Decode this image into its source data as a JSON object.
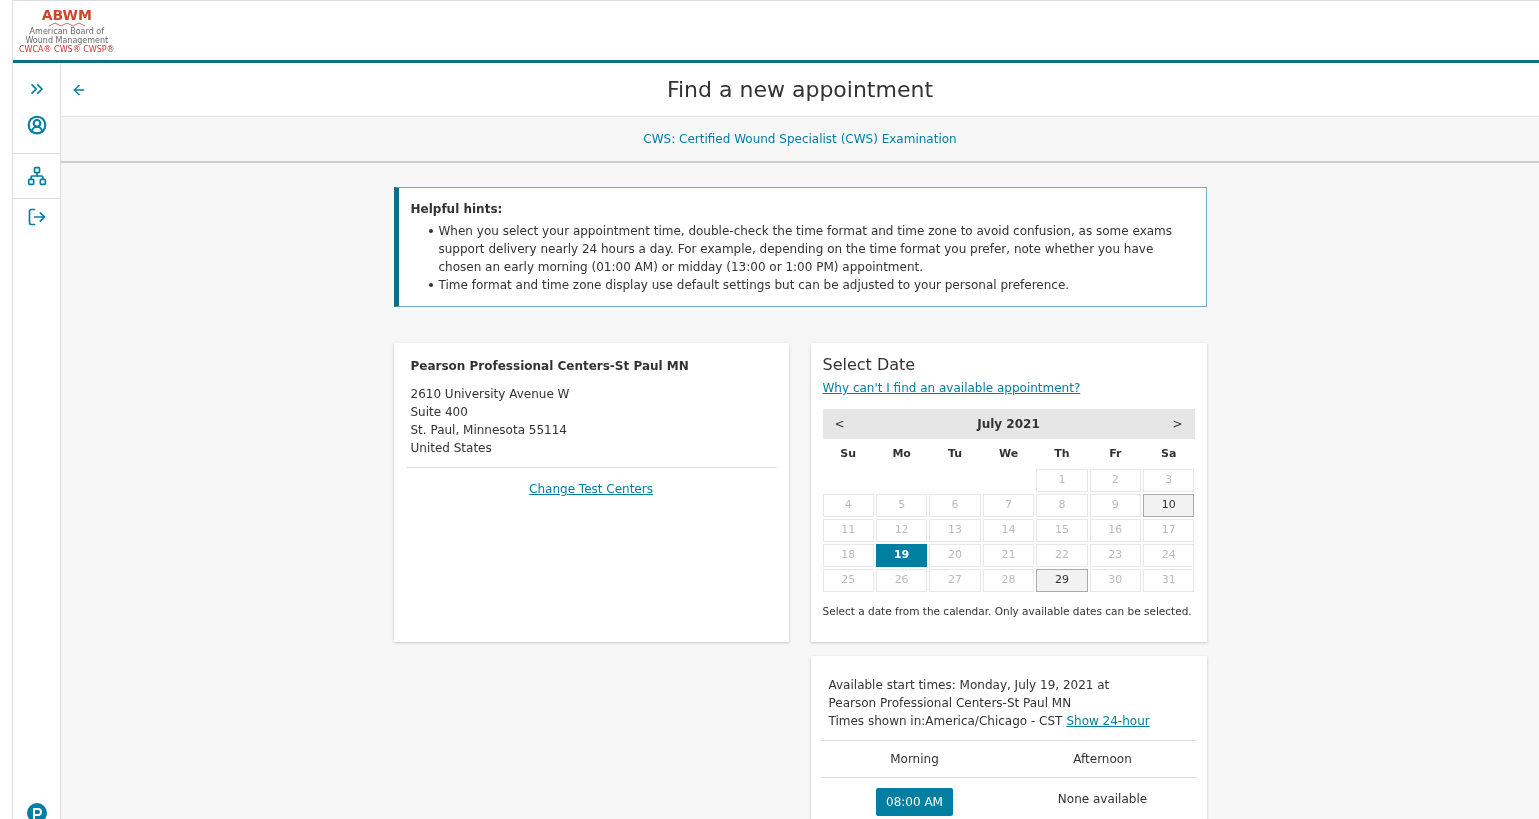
{
  "logo": {
    "mark": "ABWM",
    "name": "American Board of Wound Management",
    "credentials": "CWCA® CWS® CWSP®"
  },
  "sidebar": {
    "items": [
      {
        "kind": "expand"
      },
      {
        "kind": "profile"
      },
      {
        "kind": "tree"
      },
      {
        "kind": "logout"
      }
    ]
  },
  "page": {
    "title": "Find a new appointment",
    "exam_link": "CWS: Certified Wound Specialist (CWS) Examination"
  },
  "hints": {
    "title": "Helpful hints:",
    "items": [
      "When you select your appointment time, double-check the time format and time zone to avoid confusion, as some exams support delivery nearly 24 hours a day. For example, depending on the time format you prefer, note whether you have chosen an early morning (01:00 AM) or midday (13:00 or 1:00 PM) appointment.",
      "Time format and time zone display use default settings but can be adjusted to your personal preference."
    ]
  },
  "test_center": {
    "name": "Pearson Professional Centers-St Paul MN",
    "address": [
      "2610 University Avenue W",
      "Suite 400",
      "St. Paul, Minnesota 55114",
      "United States"
    ],
    "link": "Change Test Centers"
  },
  "calendar": {
    "title": "Select Date",
    "help_link": "Why can't I find an available appointment?",
    "prev": "<",
    "month": "July 2021",
    "next": ">",
    "weekdays": [
      "Su",
      "Mo",
      "Tu",
      "We",
      "Th",
      "Fr",
      "Sa"
    ],
    "weeks": [
      [
        {
          "kind": "blank"
        },
        {
          "kind": "blank"
        },
        {
          "kind": "blank"
        },
        {
          "kind": "blank"
        },
        {
          "kind": "day",
          "label": "1",
          "available": false,
          "selected": false
        },
        {
          "kind": "day",
          "label": "2",
          "available": false,
          "selected": false
        },
        {
          "kind": "day",
          "label": "3",
          "available": false,
          "selected": false
        }
      ],
      [
        {
          "kind": "day",
          "label": "4",
          "available": false,
          "selected": false
        },
        {
          "kind": "day",
          "label": "5",
          "available": false,
          "selected": false
        },
        {
          "kind": "day",
          "label": "6",
          "available": false,
          "selected": false
        },
        {
          "kind": "day",
          "label": "7",
          "available": false,
          "selected": false
        },
        {
          "kind": "day",
          "label": "8",
          "available": false,
          "selected": false
        },
        {
          "kind": "day",
          "label": "9",
          "available": false,
          "selected": false
        },
        {
          "kind": "day",
          "label": "10",
          "available": true,
          "selected": false
        }
      ],
      [
        {
          "kind": "day",
          "label": "11",
          "available": false,
          "selected": false
        },
        {
          "kind": "day",
          "label": "12",
          "available": false,
          "selected": false
        },
        {
          "kind": "day",
          "label": "13",
          "available": false,
          "selected": false
        },
        {
          "kind": "day",
          "label": "14",
          "available": false,
          "selected": false
        },
        {
          "kind": "day",
          "label": "15",
          "available": false,
          "selected": false
        },
        {
          "kind": "day",
          "label": "16",
          "available": false,
          "selected": false
        },
        {
          "kind": "day",
          "label": "17",
          "available": false,
          "selected": false
        }
      ],
      [
        {
          "kind": "day",
          "label": "18",
          "available": false,
          "selected": false
        },
        {
          "kind": "day",
          "label": "19",
          "available": true,
          "selected": true
        },
        {
          "kind": "day",
          "label": "20",
          "available": false,
          "selected": false
        },
        {
          "kind": "day",
          "label": "21",
          "available": false,
          "selected": false
        },
        {
          "kind": "day",
          "label": "22",
          "available": false,
          "selected": false
        },
        {
          "kind": "day",
          "label": "23",
          "available": false,
          "selected": false
        },
        {
          "kind": "day",
          "label": "24",
          "available": false,
          "selected": false
        }
      ],
      [
        {
          "kind": "day",
          "label": "25",
          "available": false,
          "selected": false
        },
        {
          "kind": "day",
          "label": "26",
          "available": false,
          "selected": false
        },
        {
          "kind": "day",
          "label": "27",
          "available": false,
          "selected": false
        },
        {
          "kind": "day",
          "label": "28",
          "available": false,
          "selected": false
        },
        {
          "kind": "day",
          "label": "29",
          "available": true,
          "selected": false
        },
        {
          "kind": "day",
          "label": "30",
          "available": false,
          "selected": false
        },
        {
          "kind": "day",
          "label": "31",
          "available": false,
          "selected": false
        }
      ]
    ],
    "note": "Select a date from the calendar. Only available dates can be selected."
  },
  "times": {
    "heading": "Available start times: Monday, July 19, 2021 at Pearson Professional Centers-St Paul MN",
    "zone": "Times shown in:America/Chicago - CST",
    "format_link": "Show 24-hour",
    "columns": [
      {
        "label": "Morning",
        "slots": [
          {
            "kind": "slot",
            "label": "08:00 AM"
          }
        ]
      },
      {
        "label": "Afternoon",
        "slots": [
          {
            "kind": "none",
            "label": "None available"
          }
        ]
      }
    ]
  }
}
